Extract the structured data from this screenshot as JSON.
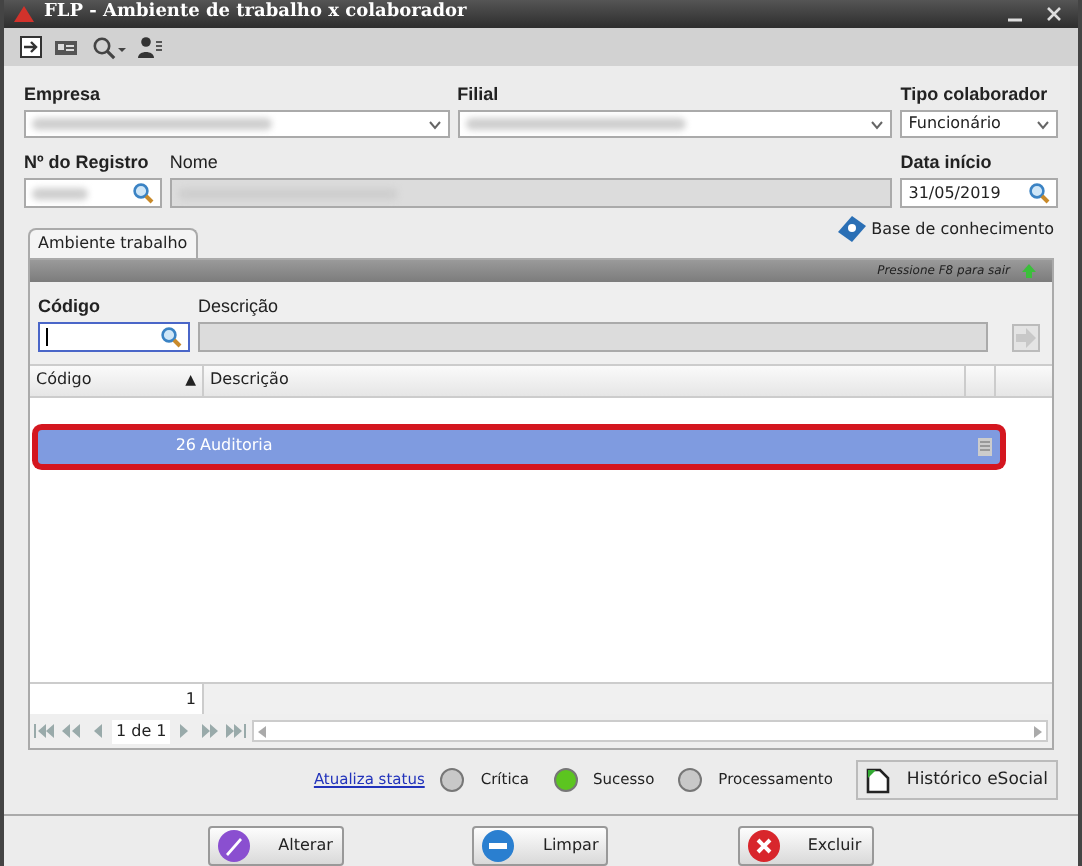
{
  "window": {
    "title": "FLP - Ambiente de trabalho x colaborador"
  },
  "header_fields": {
    "empresa": {
      "label": "Empresa"
    },
    "filial": {
      "label": "Filial"
    },
    "tipo_colaborador": {
      "label": "Tipo colaborador",
      "value": "Funcionário"
    },
    "registro": {
      "label": "Nº do Registro"
    },
    "nome": {
      "label": "Nome"
    },
    "data_inicio": {
      "label": "Data início",
      "value": "31/05/2019"
    }
  },
  "tabs": [
    {
      "label": "Ambiente trabalho",
      "selected": true
    }
  ],
  "knowledge_link": "Base de conhecimento",
  "panel_hint": "Pressione F8 para sair",
  "filter": {
    "codigo_label": "Código",
    "descricao_label": "Descrição"
  },
  "table": {
    "columns": [
      {
        "label": "Código",
        "sort": "▲"
      },
      {
        "label": "Descrição"
      }
    ],
    "rows": [
      {
        "codigo": "26",
        "descricao": "Auditoria",
        "selected": true
      }
    ],
    "footer_count": "1"
  },
  "pager": {
    "text": "1 de 1"
  },
  "status": {
    "link": "Atualiza status",
    "items": [
      {
        "label": "Crítica",
        "color": "#c8c8c8"
      },
      {
        "label": "Sucesso",
        "color": "#5cc520"
      },
      {
        "label": "Processamento",
        "color": "#c8c8c8"
      }
    ],
    "history_button": "Histórico eSocial"
  },
  "buttons": [
    {
      "kind": "edit",
      "label": "Alterar"
    },
    {
      "kind": "clear",
      "label": "Limpar"
    },
    {
      "kind": "delete",
      "label": "Excluir"
    }
  ]
}
